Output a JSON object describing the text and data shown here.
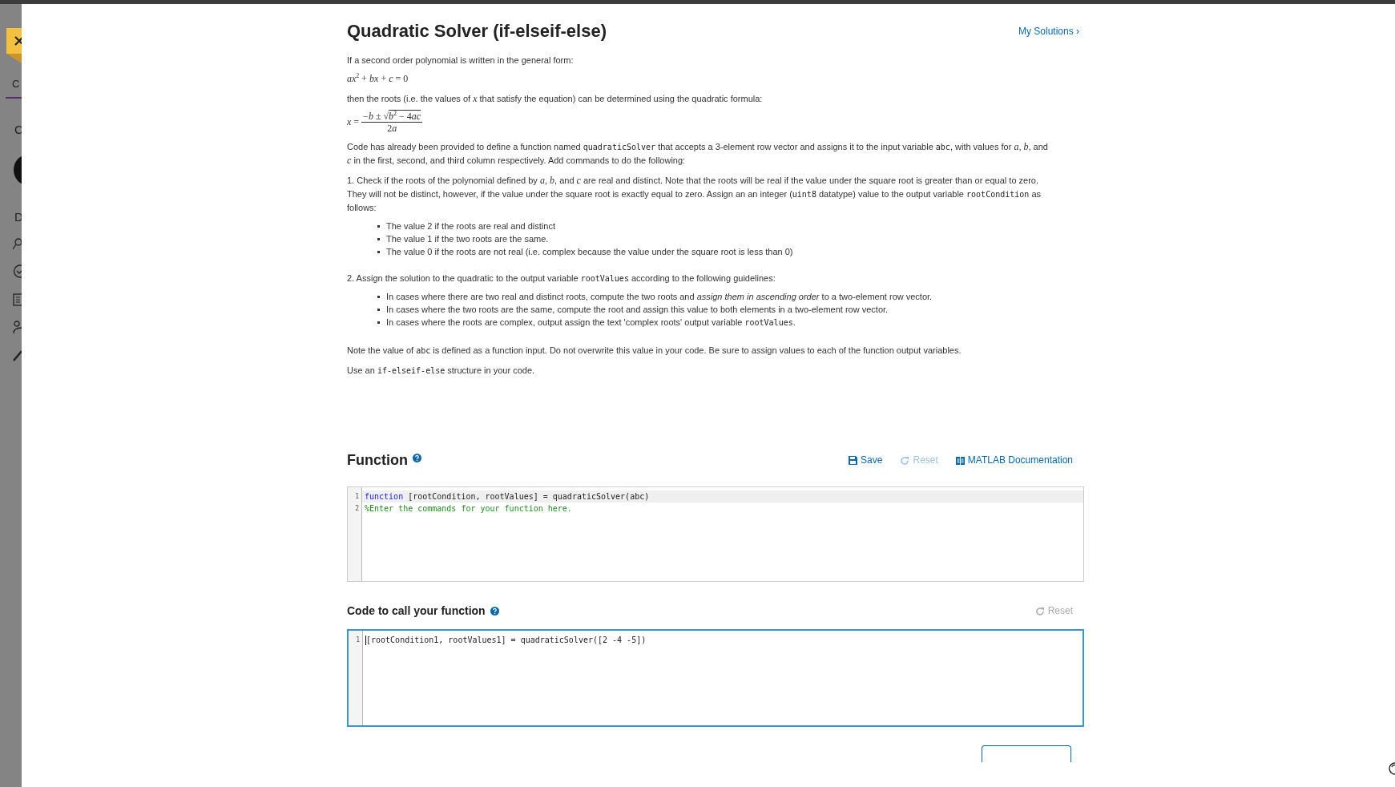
{
  "sidebar": {
    "tab": "C",
    "headings": [
      "C",
      "D"
    ]
  },
  "title": "Quadratic Solver (if-elseif-else)",
  "my_solutions": "My Solutions ›",
  "intro": [
    {
      "kind": "plain",
      "text": "If a second order polynomial is written in the general form:"
    }
  ],
  "equation": "*ax*$^{2}$ + *bx* + *c* = 0",
  "then": [
    {
      "kind": "plain",
      "text": "then the roots (i.e. the values of "
    },
    {
      "kind": "math",
      "text": "x"
    },
    {
      "kind": "plain",
      "text": " that satisfy the equation) can be determined using the quadratic formula:"
    }
  ],
  "formula": {
    "lhs": [
      {
        "kind": "math",
        "text": "x"
      },
      {
        "kind": "plain",
        "text": " ="
      }
    ],
    "numerator": [
      {
        "kind": "plain",
        "text": "−"
      },
      {
        "kind": "math",
        "text": "b"
      },
      {
        "kind": "plain",
        "text": " ± "
      }
    ],
    "radical": "√",
    "radicand": [
      {
        "kind": "math",
        "text": "b"
      },
      {
        "kind": "sup",
        "text": "2"
      },
      {
        "kind": "plain",
        "text": " − 4"
      },
      {
        "kind": "math",
        "text": "ac"
      }
    ],
    "denominator": [
      {
        "kind": "plain",
        "text": "2"
      },
      {
        "kind": "math",
        "text": "a"
      }
    ]
  },
  "paragraphs": [
    [
      {
        "kind": "plain",
        "text": "Code has already been provided to define a function named "
      },
      {
        "kind": "code",
        "text": "quadraticSolver"
      },
      {
        "kind": "plain",
        "text": " that accepts a 3-element row vector and assigns it to the input variable "
      },
      {
        "kind": "code",
        "text": "abc"
      },
      {
        "kind": "plain",
        "text": ", with values for "
      },
      {
        "kind": "math",
        "text": "a"
      },
      {
        "kind": "plain",
        "text": ", "
      },
      {
        "kind": "math",
        "text": "b"
      },
      {
        "kind": "plain",
        "text": ", and "
      },
      {
        "kind": "math",
        "text": "c"
      },
      {
        "kind": "plain",
        "text": " in the first, second, and third column respectively.  Add commands to do the following:"
      }
    ],
    [
      {
        "kind": "plain",
        "text": "1. Check if the roots of the polynomial defined by "
      },
      {
        "kind": "math",
        "text": "a"
      },
      {
        "kind": "plain",
        "text": ", "
      },
      {
        "kind": "math",
        "text": "b"
      },
      {
        "kind": "plain",
        "text": ", and "
      },
      {
        "kind": "math",
        "text": "c"
      },
      {
        "kind": "plain",
        "text": " are real and distinct. Note that the roots will be real if the value under the square root is greater than or equal to zero. They will not be distinct, however, if the value under the square root is exactly equal to zero. Assign an an integer ("
      },
      {
        "kind": "code",
        "text": "uint8"
      },
      {
        "kind": "plain",
        "text": " datatype) value to the output variable "
      },
      {
        "kind": "code",
        "text": "rootCondition"
      },
      {
        "kind": "plain",
        "text": "  as follows:"
      }
    ]
  ],
  "list_1": [
    [
      {
        "kind": "plain",
        "text": "The value 2 if the roots are real and distinct"
      }
    ],
    [
      {
        "kind": "plain",
        "text": "The value 1 if the two roots are the same."
      }
    ],
    [
      {
        "kind": "plain",
        "text": "The value 0 if the roots are not real (i.e. complex because the value under the square root is less than 0)"
      }
    ]
  ],
  "paragraph_2": [
    {
      "kind": "plain",
      "text": "2. Assign the solution to the quadratic to the output variable "
    },
    {
      "kind": "code",
      "text": "rootValues"
    },
    {
      "kind": "plain",
      "text": " according to the following guidelines:"
    }
  ],
  "list_2": [
    [
      {
        "kind": "plain",
        "text": "In cases where there are two real and distinct roots, compute the two roots and "
      },
      {
        "kind": "em",
        "text": "assign them in ascending order"
      },
      {
        "kind": "plain",
        "text": " to a two-element row vector."
      }
    ],
    [
      {
        "kind": "plain",
        "text": "In cases where the two roots are the same, compute the root and assign this value to both elements in a two-element row vector."
      }
    ],
    [
      {
        "kind": "plain",
        "text": "In cases where the roots are complex, output assign the text 'complex roots' output variable "
      },
      {
        "kind": "code",
        "text": "rootValues"
      },
      {
        "kind": "plain",
        "text": "."
      }
    ]
  ],
  "notes": [
    [
      {
        "kind": "plain",
        "text": "Note the value of "
      },
      {
        "kind": "code",
        "text": "abc"
      },
      {
        "kind": "plain",
        "text": " is defined as a function input. Do not overwrite this value in your code. Be sure to assign values to each of the function output variables."
      }
    ],
    [
      {
        "kind": "plain",
        "text": "Use an "
      },
      {
        "kind": "code",
        "text": "if-elseif-else"
      },
      {
        "kind": "plain",
        "text": " structure in your code."
      }
    ]
  ],
  "function_section": {
    "heading": "Function",
    "actions": [
      {
        "kind": "save",
        "label": "Save",
        "disabled": false
      },
      {
        "kind": "reset",
        "label": "Reset",
        "disabled": true
      },
      {
        "kind": "docs",
        "label": "MATLAB Documentation",
        "disabled": false
      }
    ],
    "editor": {
      "focused": false,
      "lines": [
        {
          "number": "1",
          "highlighted": true,
          "tokens": [
            {
              "kind": "keyword",
              "text": "function"
            },
            {
              "kind": "plain",
              "text": " [rootCondition, rootValues] = quadraticSolver(abc)"
            }
          ]
        },
        {
          "number": "2",
          "highlighted": false,
          "tokens": [
            {
              "kind": "comment",
              "text": "%Enter the commands for your function here."
            }
          ]
        }
      ]
    }
  },
  "call_section": {
    "heading": "Code to call your function",
    "actions": [
      {
        "kind": "reset",
        "label": "Reset",
        "disabled": true
      }
    ],
    "editor": {
      "focused": true,
      "lines": [
        {
          "number": "1",
          "highlighted": false,
          "tokens": [
            {
              "kind": "plain",
              "text": "[rootCondition1, rootValues1] = quadraticSolver([2 -4 -5])"
            }
          ]
        }
      ]
    }
  }
}
